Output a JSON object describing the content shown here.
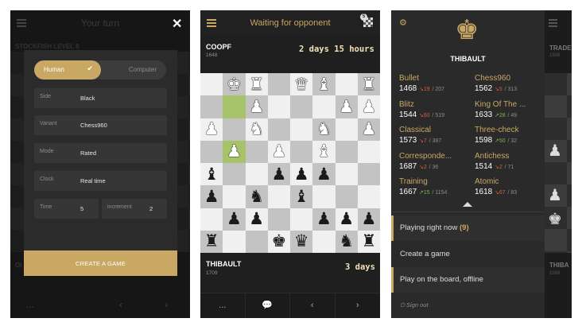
{
  "screen1": {
    "title": "Your turn",
    "bg_label_top": "STOCKFISH LEVEL 8",
    "bg_label_bottom": "OI",
    "bg_footer": [
      "...",
      "‹",
      "›"
    ],
    "modal": {
      "toggle_on": "Human",
      "toggle_off": "Computer",
      "fields": [
        {
          "label": "Side",
          "value": "Black"
        },
        {
          "label": "Variant",
          "value": "Chess960"
        },
        {
          "label": "Mode",
          "value": "Rated"
        },
        {
          "label": "Clock",
          "value": "Real time"
        }
      ],
      "time_label": "Time",
      "time_value": "5",
      "increment_label": "increment",
      "increment_value": "2",
      "create_label": "CREATE A GAME"
    }
  },
  "screen2": {
    "title": "Waiting for opponent",
    "games_badge": "5",
    "top_player": {
      "name": "COOPF",
      "rating": "1648",
      "clock": "2 days 15 hours"
    },
    "bottom_player": {
      "name": "THIBAULT",
      "rating": "1709",
      "clock": "3 days"
    },
    "footer": [
      "...",
      "💬",
      "‹",
      "›"
    ],
    "board": {
      "highlights": [
        "b7",
        "b5"
      ],
      "pieces": [
        {
          "sq": "b8",
          "p": "♚",
          "c": "w"
        },
        {
          "sq": "c8",
          "p": "♜",
          "c": "w"
        },
        {
          "sq": "e8",
          "p": "♛",
          "c": "w"
        },
        {
          "sq": "f8",
          "p": "♝",
          "c": "w"
        },
        {
          "sq": "h8",
          "p": "♜",
          "c": "w"
        },
        {
          "sq": "c7",
          "p": "♟",
          "c": "w"
        },
        {
          "sq": "g7",
          "p": "♟",
          "c": "w"
        },
        {
          "sq": "h7",
          "p": "♟",
          "c": "w"
        },
        {
          "sq": "a6",
          "p": "♟",
          "c": "w"
        },
        {
          "sq": "c6",
          "p": "♞",
          "c": "w"
        },
        {
          "sq": "f6",
          "p": "♞",
          "c": "w"
        },
        {
          "sq": "h6",
          "p": "♟",
          "c": "w"
        },
        {
          "sq": "b5",
          "p": "♟",
          "c": "w"
        },
        {
          "sq": "d5",
          "p": "♟",
          "c": "w"
        },
        {
          "sq": "f5",
          "p": "♝",
          "c": "w"
        },
        {
          "sq": "a4",
          "p": "♝",
          "c": "b"
        },
        {
          "sq": "d4",
          "p": "♟",
          "c": "b"
        },
        {
          "sq": "e4",
          "p": "♟",
          "c": "b"
        },
        {
          "sq": "f4",
          "p": "♟",
          "c": "b"
        },
        {
          "sq": "a3",
          "p": "♟",
          "c": "b"
        },
        {
          "sq": "c3",
          "p": "♞",
          "c": "b"
        },
        {
          "sq": "e3",
          "p": "♝",
          "c": "b"
        },
        {
          "sq": "b2",
          "p": "♟",
          "c": "b"
        },
        {
          "sq": "c2",
          "p": "♟",
          "c": "b"
        },
        {
          "sq": "f2",
          "p": "♟",
          "c": "b"
        },
        {
          "sq": "g2",
          "p": "♟",
          "c": "b"
        },
        {
          "sq": "h2",
          "p": "♟",
          "c": "b"
        },
        {
          "sq": "a1",
          "p": "♜",
          "c": "b"
        },
        {
          "sq": "d1",
          "p": "♚",
          "c": "b"
        },
        {
          "sq": "e1",
          "p": "♛",
          "c": "b"
        },
        {
          "sq": "g1",
          "p": "♞",
          "c": "b"
        },
        {
          "sq": "h1",
          "p": "♜",
          "c": "b"
        }
      ]
    }
  },
  "screen3": {
    "username": "THIBAULT",
    "stats": [
      {
        "name": "Bullet",
        "rating": "1468",
        "dir": "down",
        "delta": "19",
        "games": "207"
      },
      {
        "name": "Chess960",
        "rating": "1562",
        "dir": "down",
        "delta": "5",
        "games": "313"
      },
      {
        "name": "Blitz",
        "rating": "1544",
        "dir": "down",
        "delta": "60",
        "games": "519"
      },
      {
        "name": "King Of The ...",
        "rating": "1633",
        "dir": "up",
        "delta": "28",
        "games": "49"
      },
      {
        "name": "Classical",
        "rating": "1573",
        "dir": "down",
        "delta": "7",
        "games": "387"
      },
      {
        "name": "Three-check",
        "rating": "1598",
        "dir": "up",
        "delta": "50",
        "games": "32"
      },
      {
        "name": "Corresponde...",
        "rating": "1687",
        "dir": "down",
        "delta": "2",
        "games": "36"
      },
      {
        "name": "Antichess",
        "rating": "1514",
        "dir": "down",
        "delta": "2",
        "games": "71"
      },
      {
        "name": "Training",
        "rating": "1667",
        "dir": "up",
        "delta": "15",
        "games": "1154"
      },
      {
        "name": "Atomic",
        "rating": "1618",
        "dir": "down",
        "delta": "67",
        "games": "83"
      }
    ],
    "menu": {
      "playing_now": "Playing right now",
      "playing_now_count": "(9)",
      "create_game": "Create a game",
      "offline": "Play on the board, offline",
      "signout": "Sign out"
    },
    "peek": {
      "top_label": "TRADE",
      "top_sub": "1506",
      "bottom_label": "THIBA",
      "bottom_sub": "1569"
    }
  },
  "colors": {
    "accent": "#c9a864",
    "highlight": "#a7c36a",
    "down": "#d85b47",
    "up": "#7fb34a"
  }
}
